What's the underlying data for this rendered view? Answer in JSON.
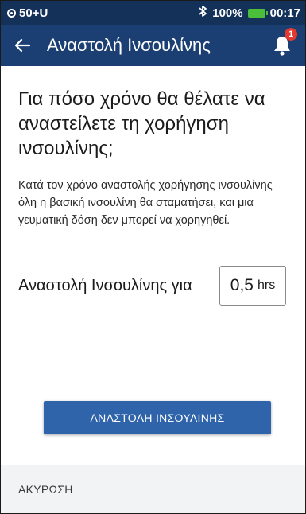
{
  "status_bar": {
    "pod_label": "50+U",
    "battery": "100%",
    "time": "00:17",
    "icons": [
      "pod-icon",
      "bluetooth-icon",
      "battery-icon"
    ],
    "battery_color": "#4bbf3a"
  },
  "header": {
    "title": "Αναστολή Ινσουλίνης",
    "notification_count": "1",
    "icons": [
      "back-arrow-icon",
      "bell-icon"
    ],
    "color": "#1c3f73",
    "badge_color": "#e23a2e"
  },
  "main": {
    "question": "Για πόσο χρόνο θα θέλατε να αναστείλετε τη χορήγηση ινσουλίνης;",
    "description": "Κατά τον χρόνο αναστολής χορήγησης ινσουλίνης όλη η βασική ινσουλίνη θα σταματήσει, και μια γευματική δόση δεν μπορεί να χορηγηθεί.",
    "duration_label": "Αναστολή Ινσουλίνης για",
    "duration_value": "0,5",
    "duration_unit": "hrs"
  },
  "actions": {
    "suspend_label": "ΑΝΑΣΤΟΛΗ ΙΝΣΟΥΛΙΝΗΣ",
    "cancel_label": "ΑΚΥΡΩΣΗ",
    "primary_color": "#2f64ab"
  }
}
